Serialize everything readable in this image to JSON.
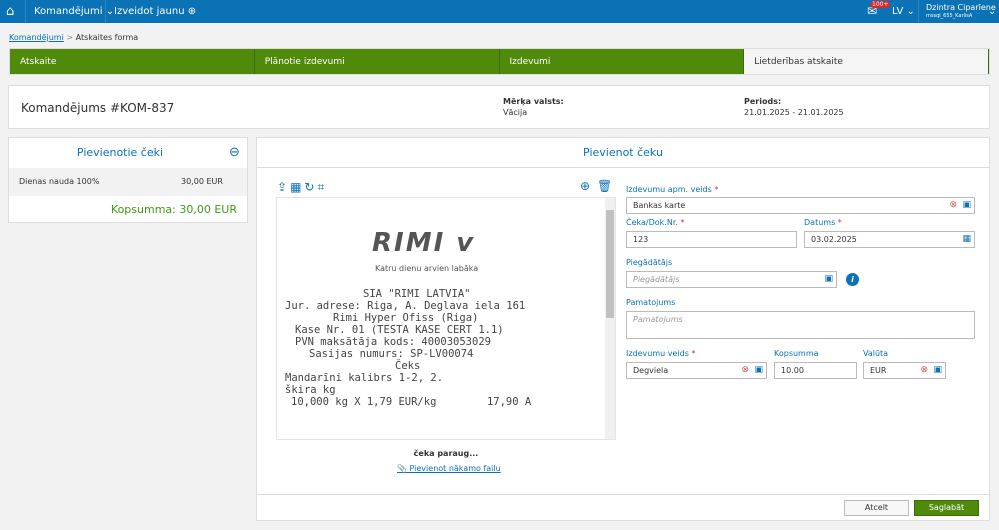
{
  "topbar": {
    "menu": "Komandējumi",
    "create": "Izveidot jaunu",
    "badge": "100+",
    "lang": "LV",
    "user_name": "Dzintra Ciparīene",
    "user_sub": "mssql_655_KarlisA"
  },
  "breadcrumb": {
    "link": "Komandējumi",
    "sep": ">",
    "current": "Atskaites forma"
  },
  "steps": [
    "Atskaite",
    "Plānotie izdevumi",
    "Izdevumi",
    "Lietderības atskaite"
  ],
  "header": {
    "title": "Komandējums #KOM-837",
    "country_label": "Mērķa valsts:",
    "country": "Vācija",
    "period_label": "Periods:",
    "period": "21.01.2025 - 21.01.2025"
  },
  "left": {
    "title": "Pievienotie čeki",
    "items": [
      {
        "name": "Dienas nauda 100%",
        "amount": "30,00 EUR"
      }
    ],
    "total": "Kopsumma: 30,00 EUR"
  },
  "right": {
    "title": "Pievienot čeku",
    "preview_label": "čeka paraug...",
    "attach_link": "Pievienot nākamo failu",
    "receipt": {
      "brand": "Rimi",
      "slogan": "Katru dienu arvien labāka",
      "lines": [
        "SIA \"RIMI LATVIA\"",
        "Jur. adrese: Riga, A. Deglava iela 161",
        "Rimi Hyper Ofiss (Riga)",
        "Kase Nr. 01 (TESTA KASE CERT 1.1)",
        "PVN maksātāja kods: 40003053029",
        "Sasijas numurs: SP-LV00074",
        "Čeks",
        "Mandarīni kalibrs 1-2, 2.",
        "škira kg",
        "10,000 kg X 1,79 EUR/kg        17,90 A"
      ]
    },
    "form": {
      "payment_label": "Izdevumu apm. veids",
      "payment": "Bankas karte",
      "doc_label": "Čeka/Dok.Nr.",
      "doc": "123",
      "date_label": "Datums",
      "date": "03.02.2025",
      "supplier_label": "Piegādātājs",
      "supplier_ph": "Piegādātājs",
      "reason_label": "Pamatojums",
      "reason_ph": "Pamatojums",
      "type_label": "Izdevumu veids",
      "type": "Degviela",
      "sum_label": "Kopsumma",
      "sum": "10.00",
      "cur_label": "Valūta",
      "cur": "EUR",
      "required": "*"
    },
    "cancel": "Atcelt",
    "save": "Saglabāt"
  }
}
